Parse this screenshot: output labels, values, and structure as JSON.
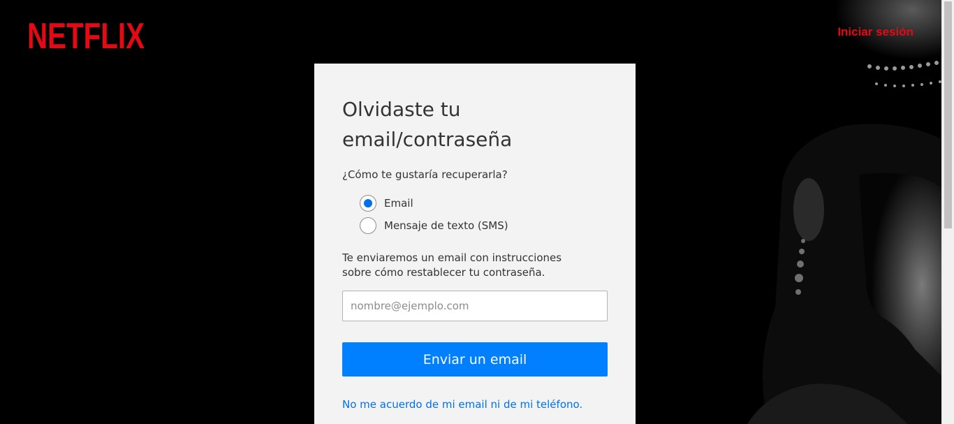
{
  "header": {
    "logo_text": "NETFLIX",
    "signin_label": "Iniciar sesión"
  },
  "form": {
    "title": "Olvidaste tu email/contraseña",
    "question": "¿Cómo te gustaría recuperarla?",
    "options": [
      {
        "label": "Email",
        "selected": true
      },
      {
        "label": "Mensaje de texto (SMS)",
        "selected": false
      }
    ],
    "instructions": "Te enviaremos un email con instrucciones sobre cómo restablecer tu contraseña.",
    "email_placeholder": "nombre@ejemplo.com",
    "email_value": "",
    "submit_label": "Enviar un email",
    "forgot_link_label": "No me acuerdo de mi email ni de mi teléfono."
  },
  "colors": {
    "brand_red": "#e50914",
    "button_blue": "#0080ff",
    "link_blue": "#0071eb",
    "card_background": "#f3f3f3",
    "page_background": "#000000"
  },
  "icons": [
    "netflix-logo",
    "radio-checked",
    "radio-unchecked"
  ]
}
